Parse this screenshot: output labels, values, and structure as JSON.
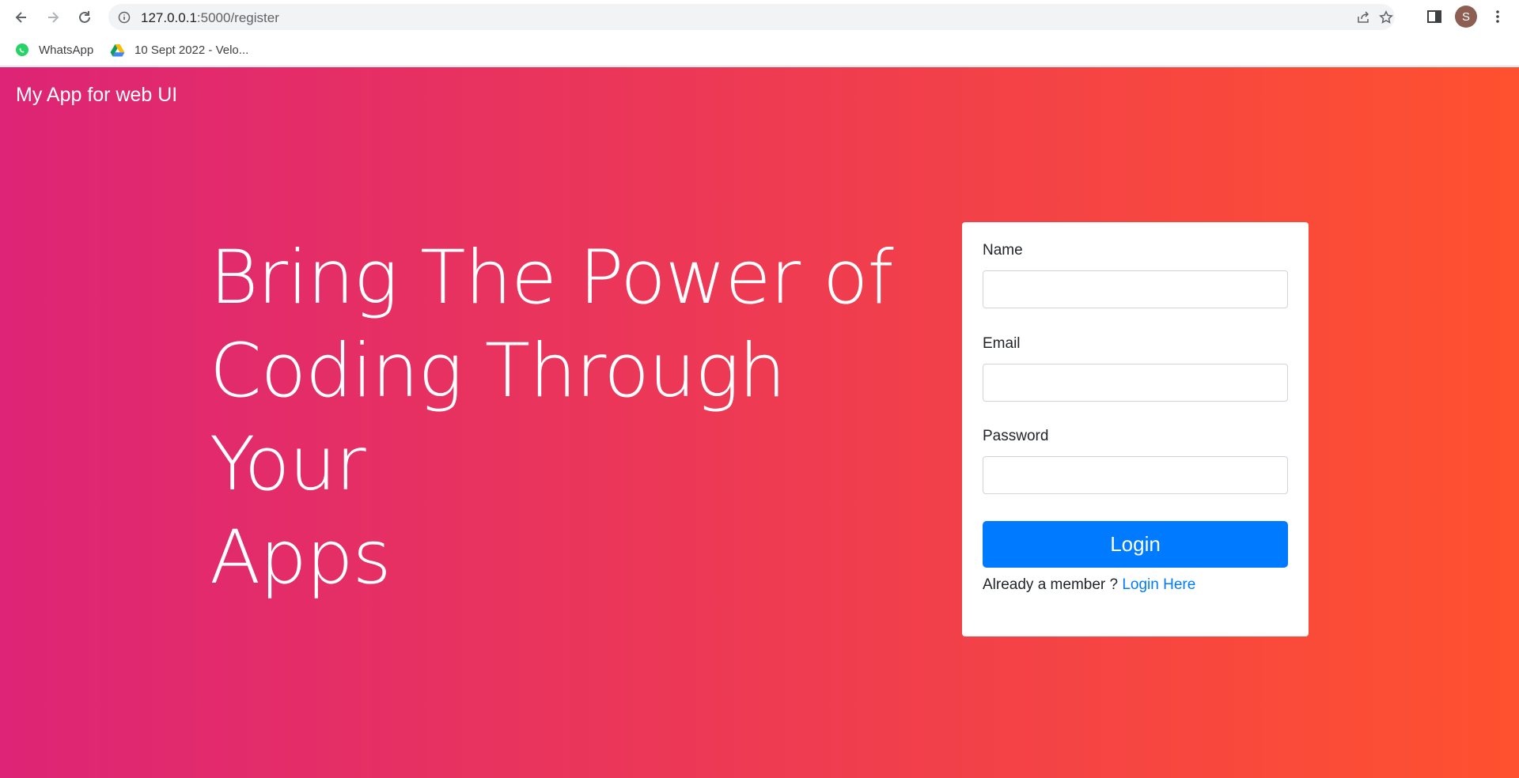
{
  "browser": {
    "url_host": "127.0.0.1",
    "url_path": ":5000/register",
    "profile_initial": "S",
    "bookmarks": [
      {
        "label": "WhatsApp",
        "icon": "whatsapp-icon"
      },
      {
        "label": "10 Sept 2022 - Velo...",
        "icon": "google-drive-icon"
      }
    ]
  },
  "navbar": {
    "brand": "My App for web UI"
  },
  "hero": {
    "line1": "Bring The Power of",
    "line2": "Coding Through Your",
    "line3": "Apps"
  },
  "form": {
    "name_label": "Name",
    "name_value": "",
    "email_label": "Email",
    "email_value": "",
    "password_label": "Password",
    "password_value": "",
    "submit_label": "Login",
    "member_text": "Already a member ?",
    "login_link": "Login Here"
  },
  "colors": {
    "gradient_start": "#dd2476",
    "gradient_end": "#ff512f",
    "primary_button": "#007bff",
    "link": "#007bff"
  }
}
